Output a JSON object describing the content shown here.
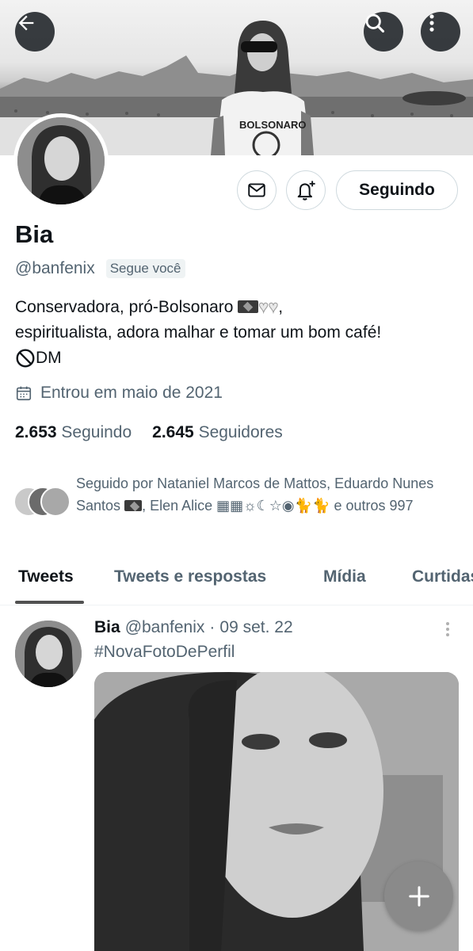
{
  "profile": {
    "name": "Bia",
    "handle": "@banfenix",
    "follows_you": "Segue você",
    "bio_line1": "Conservadora, pró-Bolsonaro",
    "bio_line1_tail": ",",
    "bio_line2": "espiritualista, adora malhar e tomar um bom café!",
    "bio_line3": "DM",
    "joined": "Entrou em maio de 2021",
    "following_count": "2.653",
    "following_label": "Seguindo",
    "followers_count": "2.645",
    "followers_label": "Seguidores",
    "shirt_text": "BOLSONARO"
  },
  "actions": {
    "following_button": "Seguindo"
  },
  "followed_by": {
    "text_part1": "Seguido por Nataniel Marcos de Mattos, Eduardo Nunes Santos",
    "text_part2": ", Elen Alice",
    "text_part3": "e outros 997"
  },
  "tabs": [
    "Tweets",
    "Tweets e respostas",
    "Mídia",
    "Curtidas"
  ],
  "tweet": {
    "name": "Bia",
    "handle": "@banfenix",
    "separator": "·",
    "date": "09 set. 22",
    "hashtag": "#NovaFotoDePerfil"
  },
  "icons": {
    "back": "arrow-left-icon",
    "search": "search-icon",
    "more": "more-vertical-icon",
    "message": "envelope-icon",
    "notify": "bell-plus-icon",
    "calendar": "calendar-icon",
    "compose": "plus-icon",
    "no_entry": "prohibited-icon"
  },
  "colors": {
    "text_primary": "#0f1419",
    "text_secondary": "#536471",
    "border": "#cfd9de"
  }
}
